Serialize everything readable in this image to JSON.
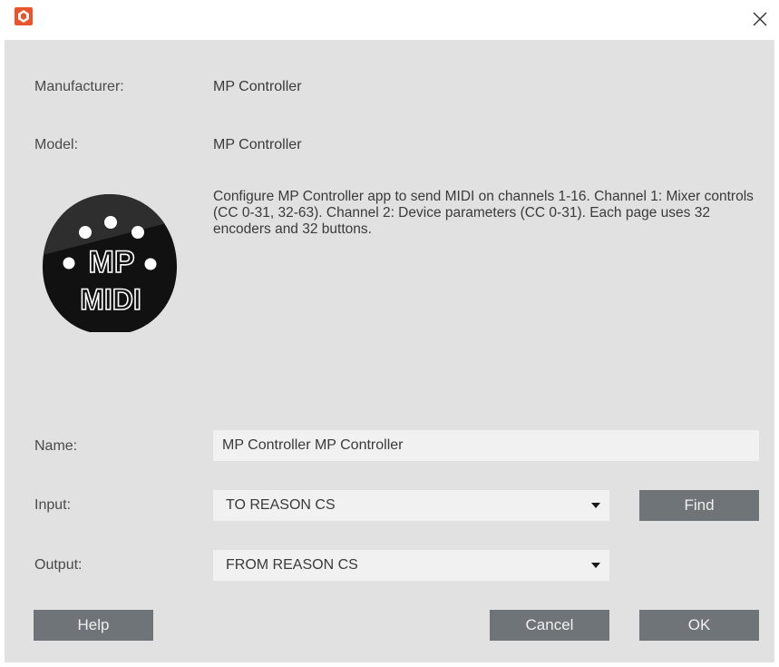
{
  "window": {
    "app_icon": "reason-app-icon",
    "close_icon": "close-icon"
  },
  "device": {
    "manufacturer_label": "Manufacturer:",
    "manufacturer_value": "MP Controller",
    "model_label": "Model:",
    "model_value": "MP Controller",
    "description": "Configure MP Controller app to send MIDI on channels 1-16. Channel 1: Mixer controls (CC 0-31, 32-63). Channel 2: Device parameters (CC 0-31). Each page uses 32 encoders and 32 buttons.",
    "logo_icon": "mp-midi-logo",
    "logo_text_line1": "MP",
    "logo_text_line2": "MIDI"
  },
  "form": {
    "name_label": "Name:",
    "name_value": "MP Controller MP Controller",
    "input_label": "Input:",
    "input_value": "TO REASON CS",
    "find_label": "Find",
    "output_label": "Output:",
    "output_value": "FROM REASON CS"
  },
  "buttons": {
    "help": "Help",
    "cancel": "Cancel",
    "ok": "OK"
  },
  "colors": {
    "accent": "#e8542b",
    "panel": "#e1e1e1",
    "field": "#f1f1f1",
    "button": "#6e7478"
  }
}
